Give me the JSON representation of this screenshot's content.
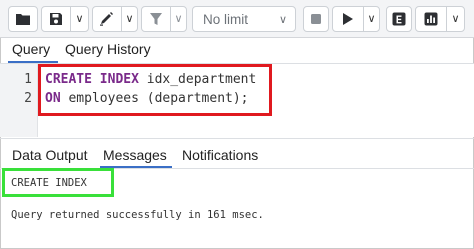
{
  "toolbar": {
    "buttons": [
      {
        "icon": "folder-open-icon",
        "caret": false
      },
      {
        "icon": "save-icon",
        "caret": true
      },
      {
        "icon": "edit-pen-icon",
        "caret": true
      },
      {
        "icon": "filter-icon",
        "caret": true
      },
      {
        "icon": "stop-icon",
        "caret": false
      },
      {
        "icon": "play-execute-icon",
        "caret": true
      },
      {
        "icon": "explain-icon",
        "caret": true
      },
      {
        "icon": "explain-analyze-chart-icon",
        "caret": true
      }
    ],
    "limit_label": "No limit",
    "caret": "∨"
  },
  "editor_tabs": {
    "query": "Query",
    "query_history": "Query History"
  },
  "editor": {
    "lines": [
      {
        "number": "1",
        "keyword": "CREATE INDEX",
        "rest": " idx_department"
      },
      {
        "number": "2",
        "keyword": "ON",
        "rest": " employees (department);"
      }
    ]
  },
  "output_tabs": {
    "data_output": "Data Output",
    "messages": "Messages",
    "notifications": "Notifications"
  },
  "messages": {
    "command": "CREATE INDEX",
    "result": "Query returned successfully in 161 msec."
  },
  "colors": {
    "highlight_red": "#e0191f",
    "highlight_green": "#39e03a",
    "keyword": "#7a2a8a",
    "active_tab_underline": "#3b6fc6"
  }
}
